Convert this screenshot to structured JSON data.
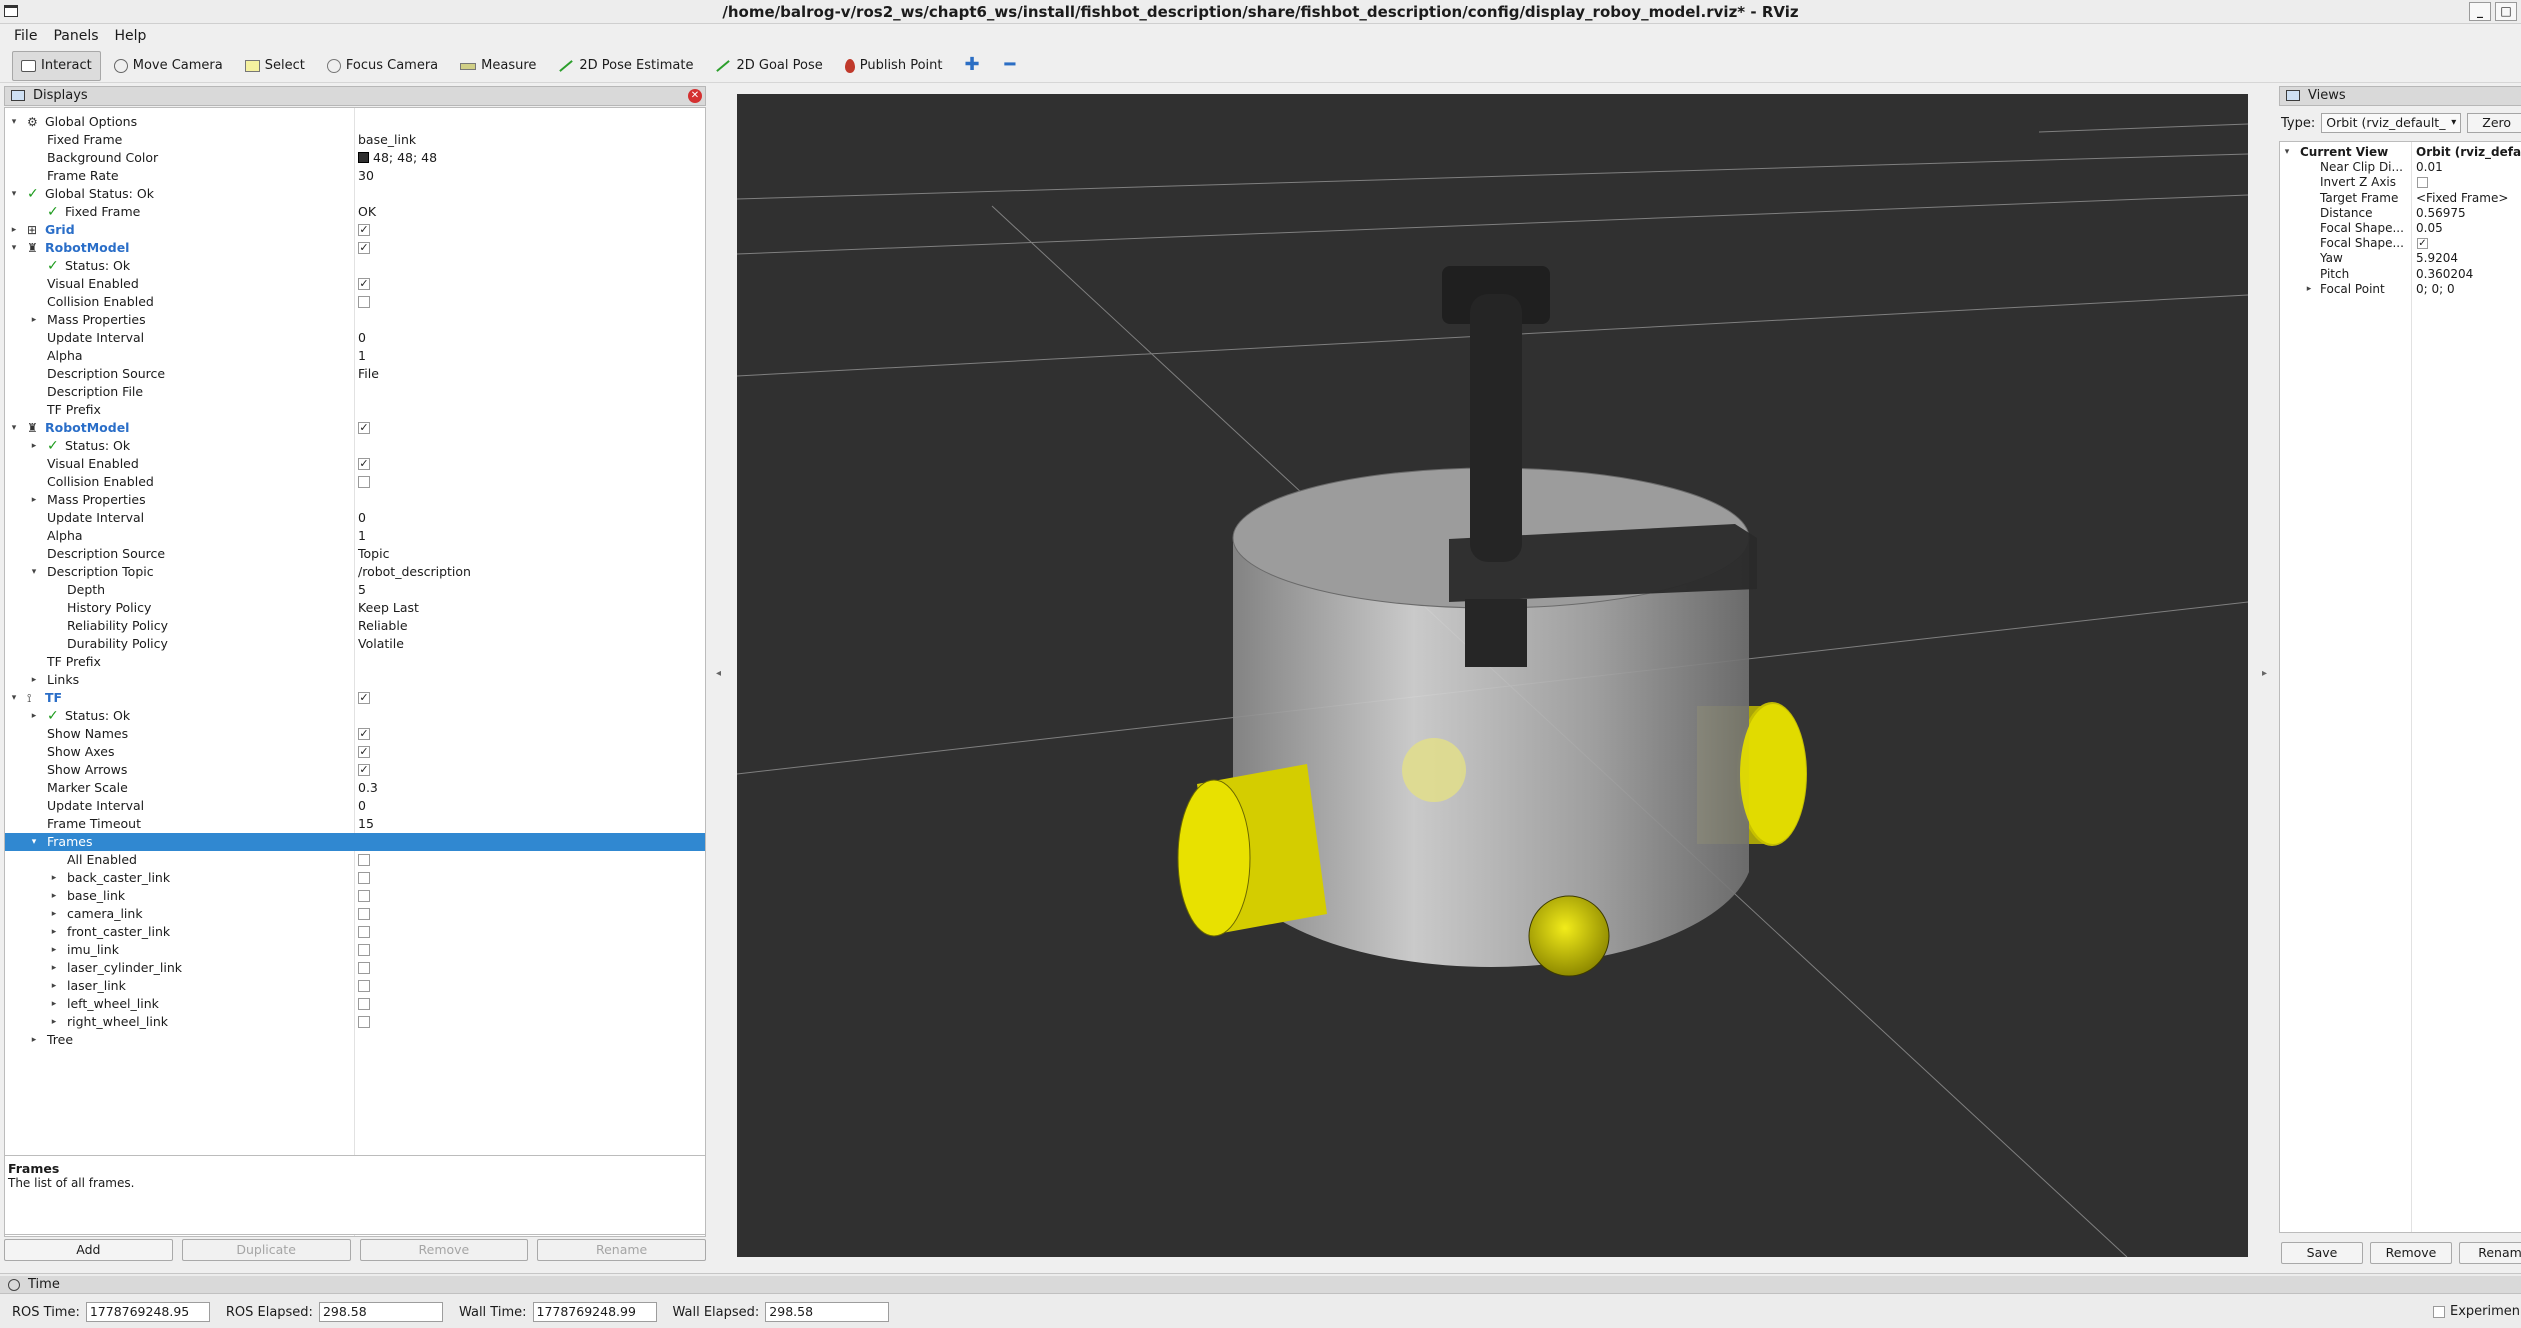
{
  "window": {
    "title": "/home/balrog-v/ros2_ws/chapt6_ws/install/fishbot_description/share/fishbot_description/config/display_roboy_model.rviz* - RViz"
  },
  "menu": [
    "File",
    "Panels",
    "Help"
  ],
  "toolbar": [
    {
      "label": "Interact",
      "icon": "interact-icon",
      "active": true
    },
    {
      "label": "Move Camera",
      "icon": "move-camera-icon"
    },
    {
      "label": "Select",
      "icon": "select-icon"
    },
    {
      "label": "Focus Camera",
      "icon": "focus-camera-icon"
    },
    {
      "label": "Measure",
      "icon": "measure-icon"
    },
    {
      "label": "2D Pose Estimate",
      "icon": "pose-estimate-icon"
    },
    {
      "label": "2D Goal Pose",
      "icon": "goal-pose-icon"
    },
    {
      "label": "Publish Point",
      "icon": "publish-point-icon"
    }
  ],
  "displays": {
    "title": "Displays",
    "rows": [
      {
        "label": "Global Options",
        "indent": 0,
        "arrow": "open",
        "icon": "globe"
      },
      {
        "label": "Fixed Frame",
        "indent": 1,
        "value": "base_link"
      },
      {
        "label": "Background Color",
        "indent": 1,
        "value": "48; 48; 48",
        "swatch": "#303030"
      },
      {
        "label": "Frame Rate",
        "indent": 1,
        "value": "30"
      },
      {
        "label": "Global Status: Ok",
        "indent": 0,
        "arrow": "open",
        "ok": true
      },
      {
        "label": "Fixed Frame",
        "indent": 1,
        "ok": true,
        "value": "OK"
      },
      {
        "label": "Grid",
        "indent": 0,
        "arrow": "closed",
        "icon": "grid",
        "blue": true,
        "check": true
      },
      {
        "label": "RobotModel",
        "indent": 0,
        "arrow": "open",
        "icon": "robot",
        "blue": true,
        "check": true
      },
      {
        "label": "Status: Ok",
        "indent": 1,
        "ok": true
      },
      {
        "label": "Visual Enabled",
        "indent": 1,
        "check": true
      },
      {
        "label": "Collision Enabled",
        "indent": 1,
        "check": false
      },
      {
        "label": "Mass Properties",
        "indent": 1,
        "arrow": "closed"
      },
      {
        "label": "Update Interval",
        "indent": 1,
        "value": "0"
      },
      {
        "label": "Alpha",
        "indent": 1,
        "value": "1"
      },
      {
        "label": "Description Source",
        "indent": 1,
        "value": "File"
      },
      {
        "label": "Description File",
        "indent": 1
      },
      {
        "label": "TF Prefix",
        "indent": 1
      },
      {
        "label": "RobotModel",
        "indent": 0,
        "arrow": "open",
        "icon": "robot",
        "blue": true,
        "check": true
      },
      {
        "label": "Status: Ok",
        "indent": 1,
        "arrow": "closed",
        "ok": true
      },
      {
        "label": "Visual Enabled",
        "indent": 1,
        "check": true
      },
      {
        "label": "Collision Enabled",
        "indent": 1,
        "check": false
      },
      {
        "label": "Mass Properties",
        "indent": 1,
        "arrow": "closed"
      },
      {
        "label": "Update Interval",
        "indent": 1,
        "value": "0"
      },
      {
        "label": "Alpha",
        "indent": 1,
        "value": "1"
      },
      {
        "label": "Description Source",
        "indent": 1,
        "value": "Topic"
      },
      {
        "label": "Description Topic",
        "indent": 1,
        "arrow": "open",
        "value": "/robot_description"
      },
      {
        "label": "Depth",
        "indent": 2,
        "value": "5"
      },
      {
        "label": "History Policy",
        "indent": 2,
        "value": "Keep Last"
      },
      {
        "label": "Reliability Policy",
        "indent": 2,
        "value": "Reliable"
      },
      {
        "label": "Durability Policy",
        "indent": 2,
        "value": "Volatile"
      },
      {
        "label": "TF Prefix",
        "indent": 1
      },
      {
        "label": "Links",
        "indent": 1,
        "arrow": "closed"
      },
      {
        "label": "TF",
        "indent": 0,
        "arrow": "open",
        "icon": "tf",
        "blue": true,
        "check": true
      },
      {
        "label": "Status: Ok",
        "indent": 1,
        "arrow": "closed",
        "ok": true
      },
      {
        "label": "Show Names",
        "indent": 1,
        "check": true
      },
      {
        "label": "Show Axes",
        "indent": 1,
        "check": true
      },
      {
        "label": "Show Arrows",
        "indent": 1,
        "check": true
      },
      {
        "label": "Marker Scale",
        "indent": 1,
        "value": "0.3"
      },
      {
        "label": "Update Interval",
        "indent": 1,
        "value": "0"
      },
      {
        "label": "Frame Timeout",
        "indent": 1,
        "value": "15"
      },
      {
        "label": "Frames",
        "indent": 1,
        "arrow": "open",
        "selected": true
      },
      {
        "label": "All Enabled",
        "indent": 2,
        "check": false
      },
      {
        "label": "back_caster_link",
        "indent": 2,
        "arrow": "closed",
        "check": false
      },
      {
        "label": "base_link",
        "indent": 2,
        "arrow": "closed",
        "check": false
      },
      {
        "label": "camera_link",
        "indent": 2,
        "arrow": "closed",
        "check": false
      },
      {
        "label": "front_caster_link",
        "indent": 2,
        "arrow": "closed",
        "check": false
      },
      {
        "label": "imu_link",
        "indent": 2,
        "arrow": "closed",
        "check": false
      },
      {
        "label": "laser_cylinder_link",
        "indent": 2,
        "arrow": "closed",
        "check": false
      },
      {
        "label": "laser_link",
        "indent": 2,
        "arrow": "closed",
        "check": false
      },
      {
        "label": "left_wheel_link",
        "indent": 2,
        "arrow": "closed",
        "check": false
      },
      {
        "label": "right_wheel_link",
        "indent": 2,
        "arrow": "closed",
        "check": false
      },
      {
        "label": "Tree",
        "indent": 1,
        "arrow": "closed"
      }
    ],
    "description": {
      "title": "Frames",
      "body": "The list of all frames."
    },
    "buttons": {
      "add": "Add",
      "duplicate": "Duplicate",
      "remove": "Remove",
      "rename": "Rename"
    }
  },
  "views": {
    "title": "Views",
    "type_label": "Type:",
    "type_value": "Orbit (rviz_default_",
    "zero_label": "Zero",
    "header": {
      "label": "Current View",
      "value": "Orbit (rviz_defa"
    },
    "rows": [
      {
        "label": "Near Clip Di...",
        "value": "0.01"
      },
      {
        "label": "Invert Z Axis",
        "check": false
      },
      {
        "label": "Target Frame",
        "value": "<Fixed Frame>"
      },
      {
        "label": "Distance",
        "value": "0.56975"
      },
      {
        "label": "Focal Shape...",
        "value": "0.05"
      },
      {
        "label": "Focal Shape...",
        "check": true
      },
      {
        "label": "Yaw",
        "value": "5.9204"
      },
      {
        "label": "Pitch",
        "value": "0.360204"
      },
      {
        "label": "Focal Point",
        "value": "0; 0; 0",
        "arrow": "closed"
      }
    ],
    "buttons": {
      "save": "Save",
      "remove": "Remove",
      "rename": "Renam"
    }
  },
  "time": {
    "title": "Time",
    "ros_time_label": "ROS Time:",
    "ros_time": "1778769248.95",
    "ros_elapsed_label": "ROS Elapsed:",
    "ros_elapsed": "298.58",
    "wall_time_label": "Wall Time:",
    "wall_time": "1778769248.99",
    "wall_elapsed_label": "Wall Elapsed:",
    "wall_elapsed": "298.58",
    "experimental_label": "Experimen"
  },
  "colors": {
    "background": "#303030",
    "selection": "#3088d1",
    "wheel": "#d8d000",
    "body": "#cfcfcf"
  }
}
